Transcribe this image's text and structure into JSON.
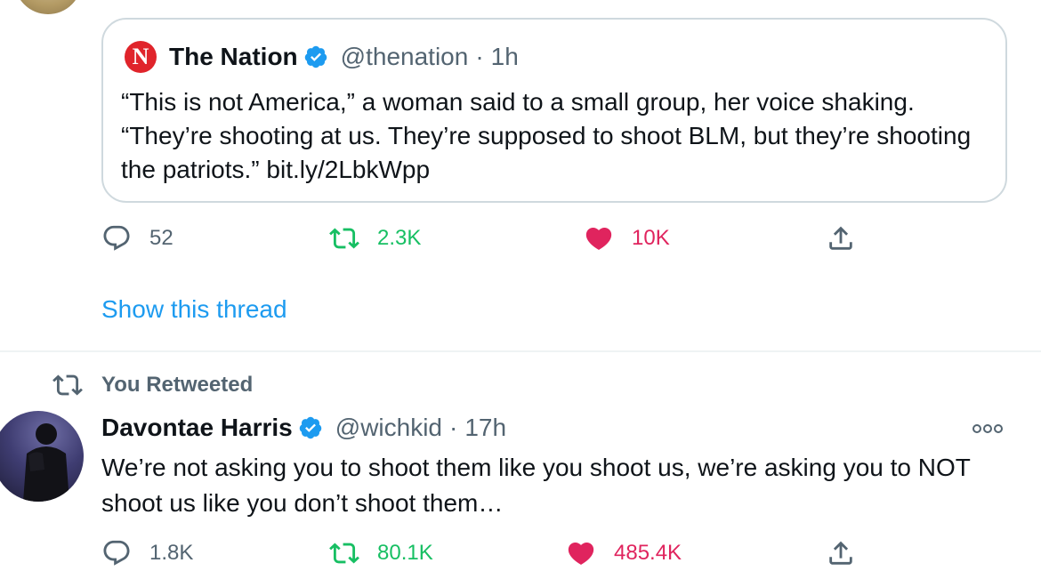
{
  "quoted_tweet": {
    "logo_letter": "N",
    "name": "The Nation",
    "handle": "@thenation",
    "separator": "·",
    "time": "1h",
    "text": "“This is not America,” a woman said to a small group, her voice shaking. “They’re shooting at us. They’re supposed to shoot BLM, but they’re shooting the patriots.” bit.ly/2LbkWpp"
  },
  "thread_actions": {
    "replies": "52",
    "retweets": "2.3K",
    "likes": "10K"
  },
  "show_thread": "Show this thread",
  "retweet_banner": "You Retweeted",
  "tweet": {
    "name": "Davontae Harris",
    "handle": "@wichkid",
    "separator": "·",
    "time": "17h",
    "text": "We’re not asking you to shoot them like you shoot us, we’re asking you to NOT shoot us like you don’t shoot them…"
  },
  "tweet_actions": {
    "replies": "1.8K",
    "retweets": "80.1K",
    "likes": "485.4K"
  },
  "colors": {
    "link_blue": "#1d9bf0",
    "retweet_green": "#17bf63",
    "like_red": "#e0245e",
    "muted_gray": "#536471"
  },
  "icons": [
    "reply-icon",
    "retweet-icon",
    "like-icon",
    "share-icon",
    "verified-badge-icon",
    "more-options-icon"
  ]
}
